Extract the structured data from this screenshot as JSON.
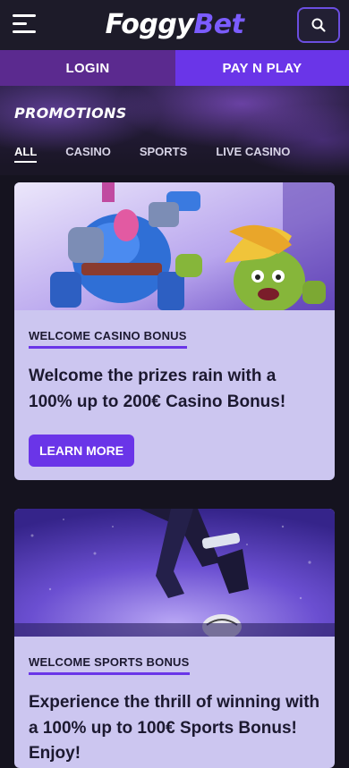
{
  "header": {
    "logo_part1": "Foggy",
    "logo_part2": "Bet",
    "menu_icon": "hamburger-icon",
    "search_icon": "search-icon"
  },
  "auth": {
    "login_label": "LOGIN",
    "pay_label": "PAY N PLAY"
  },
  "promotions": {
    "title": "PROMOTIONS",
    "tabs": [
      "ALL",
      "CASINO",
      "SPORTS",
      "LIVE CASINO"
    ],
    "active_tab": "ALL"
  },
  "cards": [
    {
      "kicker": "WELCOME CASINO BONUS",
      "title": "Welcome the prizes rain with a 100% up to 200€ Casino Bonus!",
      "button": "LEARN MORE"
    },
    {
      "kicker": "WELCOME SPORTS BONUS",
      "title": "Experience the thrill of winning with a 100% up to 100€ Sports Bonus! Enjoy!"
    }
  ],
  "colors": {
    "accent": "#6a35e8",
    "login_bg": "#5b2a8f",
    "card_bg": "#ccc6f0",
    "page_bg": "#15131f"
  }
}
